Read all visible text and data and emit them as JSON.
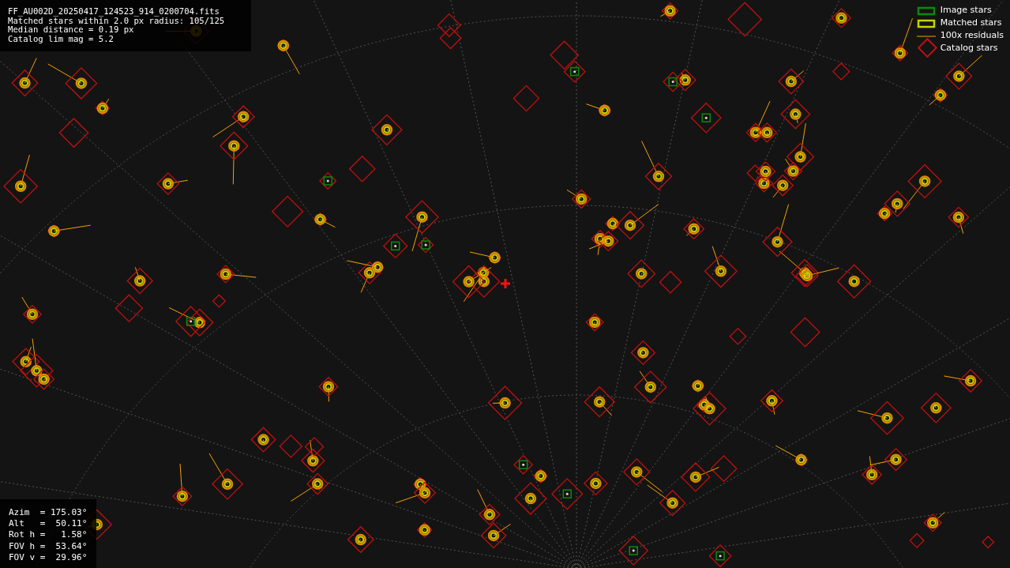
{
  "info_lines": [
    "FF_AU002D_20250417_124523_914_0200704.fits",
    "Matched stars within 2.0 px radius: 105/125",
    "Median distance = 0.19 px",
    "Catalog lim mag = 5.2"
  ],
  "pointing_lines": [
    "Azim  = 175.03°",
    "Alt   =  50.11°",
    "Rot h =   1.58°",
    "FOV h =  53.64°",
    "FOV v =  29.96°"
  ],
  "legend": [
    {
      "kind": "image",
      "label": "Image stars"
    },
    {
      "kind": "matched",
      "label": "Matched stars"
    },
    {
      "kind": "residual",
      "label": "100x residuals"
    },
    {
      "kind": "catalog",
      "label": "Catalog stars"
    }
  ]
}
